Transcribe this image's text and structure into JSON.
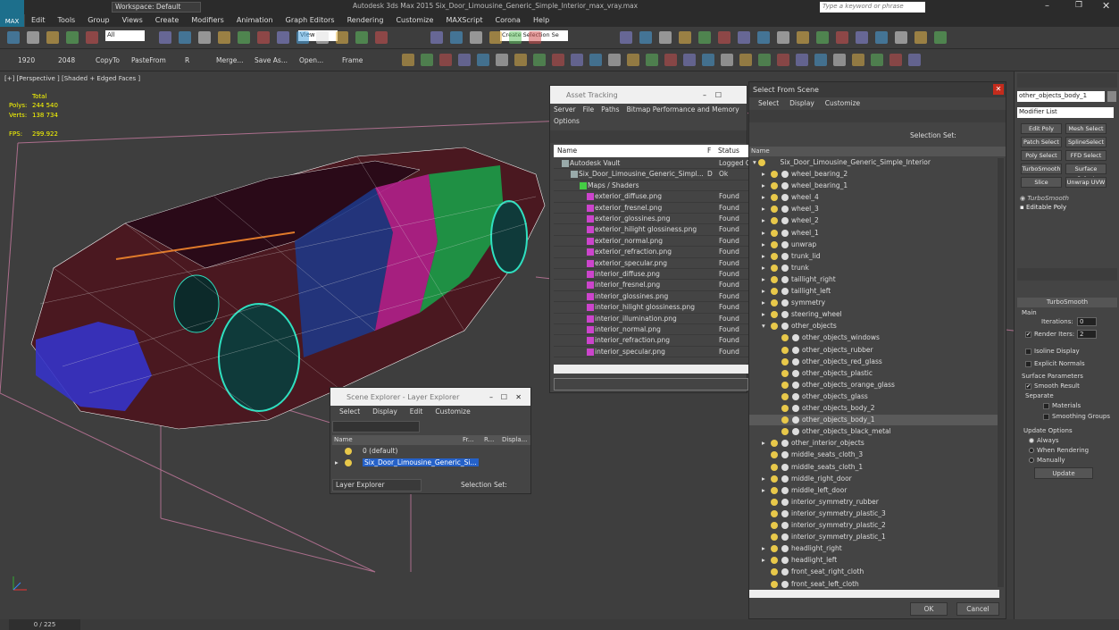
{
  "title_bar": {
    "workspace_label": "Workspace: Default",
    "app_title": "Autodesk 3ds Max 2015    Six_Door_Limousine_Generic_Simple_Interior_max_vray.max",
    "search_placeholder": "Type a keyword or phrase"
  },
  "menu": [
    "Edit",
    "Tools",
    "Group",
    "Views",
    "Create",
    "Modifiers",
    "Animation",
    "Graph Editors",
    "Rendering",
    "Customize",
    "MAXScript",
    "Corona",
    "Help"
  ],
  "toolbar": {
    "filter_value": "All",
    "view_value": "View",
    "selection_set_value": "Create Selection Se"
  },
  "toolbar2": {
    "labels": [
      "1920",
      "2048",
      "CopyTo",
      "PasteFrom",
      "R",
      "Merge...",
      "Save As...",
      "Open...",
      "Frame"
    ]
  },
  "viewport": {
    "label": "[+] [Perspective ] [Shaded + Edged Faces ]",
    "stats": {
      "total": "Total",
      "polys_label": "Polys:",
      "polys": "244 540",
      "verts_label": "Verts:",
      "verts": "138 734",
      "fps_label": "FPS:",
      "fps": "299.922"
    }
  },
  "asset_tracking": {
    "title": "Asset Tracking",
    "menus": [
      "Server",
      "File",
      "Paths",
      "Bitmap Performance and Memory",
      "Options"
    ],
    "columns": [
      "Name",
      "F",
      "Status"
    ],
    "rows": [
      {
        "name": "Autodesk Vault",
        "f": "",
        "status": "Logged O"
      },
      {
        "name": "Six_Door_Limousine_Generic_Simpl...",
        "f": "D",
        "status": "Ok"
      },
      {
        "name": "Maps / Shaders",
        "f": "",
        "status": ""
      },
      {
        "name": "exterior_diffuse.png",
        "f": "",
        "status": "Found"
      },
      {
        "name": "exterior_fresnel.png",
        "f": "",
        "status": "Found"
      },
      {
        "name": "exterior_glossines.png",
        "f": "",
        "status": "Found"
      },
      {
        "name": "exterior_hilight glossiness.png",
        "f": "",
        "status": "Found"
      },
      {
        "name": "exterior_normal.png",
        "f": "",
        "status": "Found"
      },
      {
        "name": "exterior_refraction.png",
        "f": "",
        "status": "Found"
      },
      {
        "name": "exterior_specular.png",
        "f": "",
        "status": "Found"
      },
      {
        "name": "interior_diffuse.png",
        "f": "",
        "status": "Found"
      },
      {
        "name": "interior_fresnel.png",
        "f": "",
        "status": "Found"
      },
      {
        "name": "interior_glossines.png",
        "f": "",
        "status": "Found"
      },
      {
        "name": "interior_hilight glossiness.png",
        "f": "",
        "status": "Found"
      },
      {
        "name": "interior_illumination.png",
        "f": "",
        "status": "Found"
      },
      {
        "name": "interior_normal.png",
        "f": "",
        "status": "Found"
      },
      {
        "name": "interior_refraction.png",
        "f": "",
        "status": "Found"
      },
      {
        "name": "interior_specular.png",
        "f": "",
        "status": "Found"
      }
    ]
  },
  "scene_explorer": {
    "title": "Scene Explorer - Layer Explorer",
    "menus": [
      "Select",
      "Display",
      "Edit",
      "Customize"
    ],
    "columns": [
      "Name",
      "Fr...",
      "R...",
      "Displa..."
    ],
    "rows": [
      {
        "name": "0 (default)"
      },
      {
        "name": "Six_Door_Limousine_Generic_Si..."
      }
    ],
    "footer_dropdown": "Layer Explorer",
    "selection_set_label": "Selection Set:"
  },
  "select_from_scene": {
    "title": "Select From Scene",
    "tabs": [
      "Select",
      "Display",
      "Customize"
    ],
    "selection_set_label": "Selection Set:",
    "column_name": "Name",
    "root": "Six_Door_Limousine_Generic_Simple_Interior",
    "items": [
      {
        "name": "wheel_bearing_2",
        "level": 1
      },
      {
        "name": "wheel_bearing_1",
        "level": 1
      },
      {
        "name": "wheel_4",
        "level": 1
      },
      {
        "name": "wheel_3",
        "level": 1
      },
      {
        "name": "wheel_2",
        "level": 1
      },
      {
        "name": "wheel_1",
        "level": 1
      },
      {
        "name": "unwrap",
        "level": 1
      },
      {
        "name": "trunk_lid",
        "level": 1
      },
      {
        "name": "trunk",
        "level": 1
      },
      {
        "name": "taillight_right",
        "level": 1
      },
      {
        "name": "taillight_left",
        "level": 1
      },
      {
        "name": "symmetry",
        "level": 1
      },
      {
        "name": "steering_wheel",
        "level": 1
      },
      {
        "name": "other_objects",
        "level": 1
      },
      {
        "name": "other_objects_windows",
        "level": 2
      },
      {
        "name": "other_objects_rubber",
        "level": 2
      },
      {
        "name": "other_objects_red_glass",
        "level": 2
      },
      {
        "name": "other_objects_plastic",
        "level": 2
      },
      {
        "name": "other_objects_orange_glass",
        "level": 2
      },
      {
        "name": "other_objects_glass",
        "level": 2
      },
      {
        "name": "other_objects_body_2",
        "level": 2
      },
      {
        "name": "other_objects_body_1",
        "level": 2
      },
      {
        "name": "other_objects_black_metal",
        "level": 2
      },
      {
        "name": "other_interior_objects",
        "level": 1
      },
      {
        "name": "middle_seats_cloth_3",
        "level": 1
      },
      {
        "name": "middle_seats_cloth_1",
        "level": 1
      },
      {
        "name": "middle_right_door",
        "level": 1
      },
      {
        "name": "middle_left_door",
        "level": 1
      },
      {
        "name": "interior_symmetry_rubber",
        "level": 1
      },
      {
        "name": "interior_symmetry_plastic_3",
        "level": 1
      },
      {
        "name": "interior_symmetry_plastic_2",
        "level": 1
      },
      {
        "name": "interior_symmetry_plastic_1",
        "level": 1
      },
      {
        "name": "headlight_right",
        "level": 1
      },
      {
        "name": "headlight_left",
        "level": 1
      },
      {
        "name": "front_seat_right_cloth",
        "level": 1
      },
      {
        "name": "front_seat_left_cloth",
        "level": 1
      }
    ],
    "ok_label": "OK",
    "cancel_label": "Cancel"
  },
  "command_panel": {
    "object_name": "other_objects_body_1",
    "modifier_list": "Modifier List",
    "buttons": [
      "Edit Poly",
      "Mesh Select",
      "Patch Select",
      "SplineSelect",
      "Poly Select",
      "FFD Select",
      "TurboSmooth",
      "Surface Select",
      "Slice",
      "Unwrap UVW"
    ],
    "stack": [
      "TurboSmooth",
      "Editable Poly"
    ],
    "rollout_title": "TurboSmooth",
    "main_label": "Main",
    "iterations_label": "Iterations:",
    "iterations": "0",
    "render_iters_label": "Render Iters:",
    "render_iters": "2",
    "isoline_label": "Isoline Display",
    "explicit_label": "Explicit Normals",
    "surface_label": "Surface Parameters",
    "smooth_label": "Smooth Result",
    "separate_label": "Separate",
    "materials_label": "Materials",
    "smoothing_label": "Smoothing Groups",
    "update_options_label": "Update Options",
    "always_label": "Always",
    "when_rendering_label": "When Rendering",
    "manually_label": "Manually",
    "update_button": "Update"
  },
  "status": {
    "frame": "0 / 225"
  }
}
